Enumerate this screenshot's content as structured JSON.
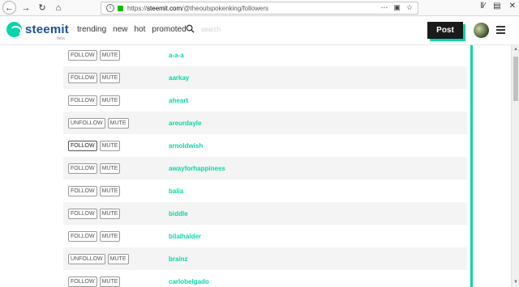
{
  "browser": {
    "url_prefix": "https://",
    "url_host": "steemit.com",
    "url_path": "/@theoutspokenking/followers",
    "icons": [
      "back-icon",
      "forward-icon",
      "reload-icon",
      "home-icon",
      "info-icon",
      "lock-icon",
      "more-icon",
      "pocket-icon",
      "bookmark-star-icon",
      "library-icon",
      "sidebar-icon",
      "close-icon"
    ]
  },
  "header": {
    "logo_text": "steemit",
    "logo_beta": "beta",
    "nav": [
      "trending",
      "new",
      "hot",
      "promoted"
    ],
    "search_placeholder": "search",
    "post_label": "Post",
    "accent_color": "#06d6a9"
  },
  "followers": [
    {
      "follow": "FOLLOW",
      "mute": "MUTE",
      "name": "a-a-a"
    },
    {
      "follow": "FOLLOW",
      "mute": "MUTE",
      "name": "aarkay"
    },
    {
      "follow": "FOLLOW",
      "mute": "MUTE",
      "name": "aheart"
    },
    {
      "follow": "UNFOLLOW",
      "mute": "MUTE",
      "name": "areurdayle"
    },
    {
      "follow": "FOLLOW",
      "mute": "MUTE",
      "name": "arnoldwish"
    },
    {
      "follow": "FOLLOW",
      "mute": "MUTE",
      "name": "awayforhappiness"
    },
    {
      "follow": "FOLLOW",
      "mute": "MUTE",
      "name": "balia"
    },
    {
      "follow": "FOLLOW",
      "mute": "MUTE",
      "name": "biddle"
    },
    {
      "follow": "FOLLOW",
      "mute": "MUTE",
      "name": "bilalhaider"
    },
    {
      "follow": "UNFOLLOW",
      "mute": "MUTE",
      "name": "brainz"
    },
    {
      "follow": "FOLLOW",
      "mute": "MUTE",
      "name": "carlobelgado"
    }
  ]
}
